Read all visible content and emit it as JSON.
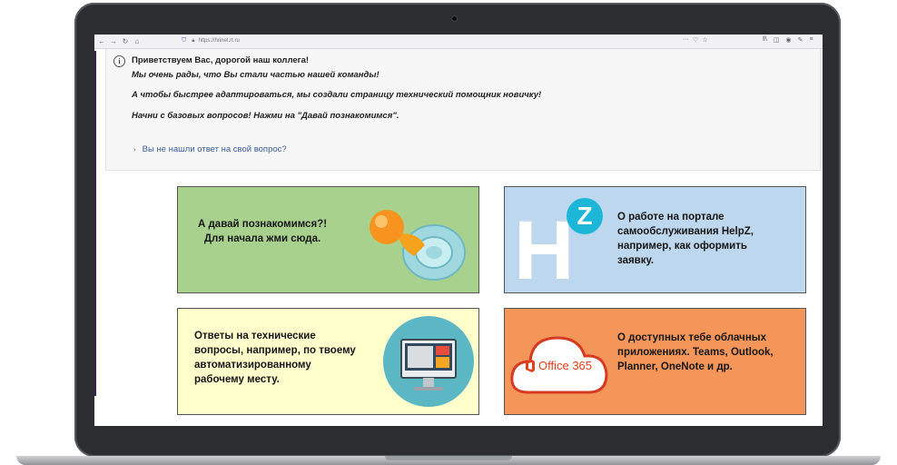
{
  "browser": {
    "url": "https://hrinet.rt.ru"
  },
  "info": {
    "title": "Приветствуем Вас, дорогой наш коллега!",
    "line1": "Мы очень рады, что Вы стали частью нашей команды!",
    "line2": "А чтобы быстрее адаптироваться, мы создали страницу технический помощник новичку!",
    "line3": "Начни с базовых вопросов! Нажми на \"Давай познакомимся\".",
    "faq_link": "Вы не нашли ответ на свой вопрос?"
  },
  "cards": [
    {
      "text_line1": "А давай познакомимся?!",
      "text_line2": "Для начала жми сюда.",
      "icon": "pacifier-icon",
      "color": "#a8d18e"
    },
    {
      "text_line1": "О работе на портале",
      "text_line2": "самообслуживания HelpZ,",
      "text_line3": "например, как оформить",
      "text_line4": "заявку.",
      "logo_letter_h": "H",
      "logo_letter_z": "Z",
      "icon": "helpz-logo",
      "color": "#bdd7ee"
    },
    {
      "text_line1": "Ответы на технические",
      "text_line2": "вопросы, например, по твоему",
      "text_line3": "автоматизированному",
      "text_line4": "рабочему месту.",
      "icon": "monitor-icon",
      "color": "#ffffcc"
    },
    {
      "text_line1": "О доступных тебе облачных",
      "text_line2": "приложениях. Teams, Outlook,",
      "text_line3": "Planner, OneNote и др.",
      "logo_text": "Office 365",
      "icon": "office365-cloud-icon",
      "color": "#f4965a"
    }
  ]
}
